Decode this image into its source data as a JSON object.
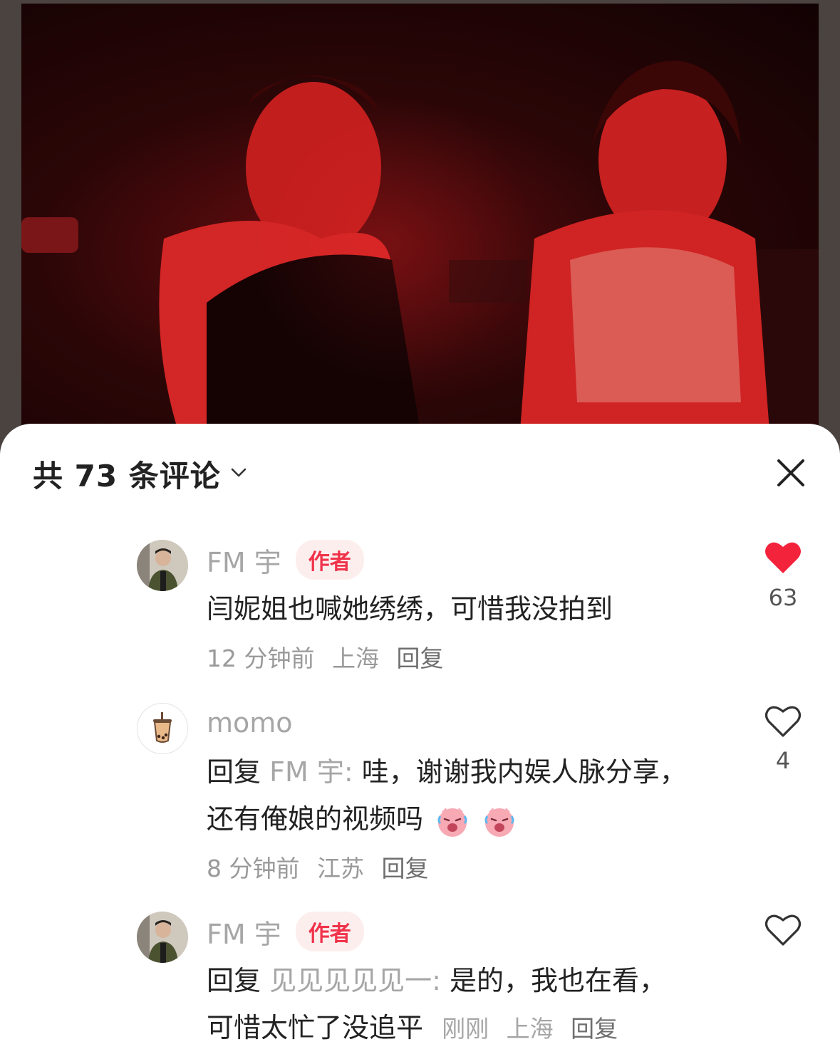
{
  "header": {
    "comment_count_label": "共 73 条评论"
  },
  "colors": {
    "accent": "#f0334b",
    "muted_text": "#a6a6a6",
    "body_text": "#222222"
  },
  "comments": [
    {
      "username": "FM 宇",
      "badge": "作者",
      "text": "闫妮姐也喊她绣绣，可惜我没拍到",
      "time": "12 分钟前",
      "location": "上海",
      "reply_label": "回复",
      "likes": "63",
      "liked": true
    },
    {
      "username": "momo",
      "reply_prefix": "回复",
      "reply_target": "FM 宇:",
      "text_line1": " 哇，谢谢我内娱人脉分享，",
      "text_line2": "还有俺娘的视频吗",
      "emoji": [
        "crying-laughing-pig-emoji",
        "crying-laughing-pig-emoji"
      ],
      "time": "8 分钟前",
      "location": "江苏",
      "reply_label": "回复",
      "likes": "4",
      "liked": false
    },
    {
      "username": "FM 宇",
      "badge": "作者",
      "reply_prefix": "回复",
      "reply_target": "见见见见见一:",
      "text_line1": " 是的，我也在看，",
      "text_line2": "可惜太忙了没追平",
      "time": "刚刚",
      "location": "上海",
      "reply_label": "回复",
      "liked": false
    }
  ]
}
